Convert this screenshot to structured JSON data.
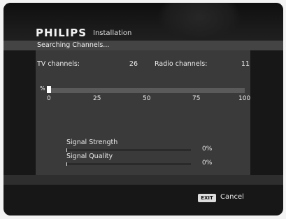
{
  "header": {
    "brand": "PHILIPS",
    "screen_title": "Installation",
    "status": "Searching Channels..."
  },
  "counts": {
    "tv_label": "TV channels:",
    "tv_value": "26",
    "radio_label": "Radio channels:",
    "radio_value": "11"
  },
  "search_progress": {
    "unit_label": "%",
    "percent": 2,
    "ticks": [
      "0",
      "25",
      "50",
      "75",
      "100"
    ]
  },
  "signal": {
    "strength_label": "Signal Strength",
    "strength_value": "0%",
    "strength_percent": 0,
    "quality_label": "Signal Quality",
    "quality_value": "0%",
    "quality_percent": 0
  },
  "footer": {
    "exit_key": "EXIT",
    "cancel_label": "Cancel"
  }
}
